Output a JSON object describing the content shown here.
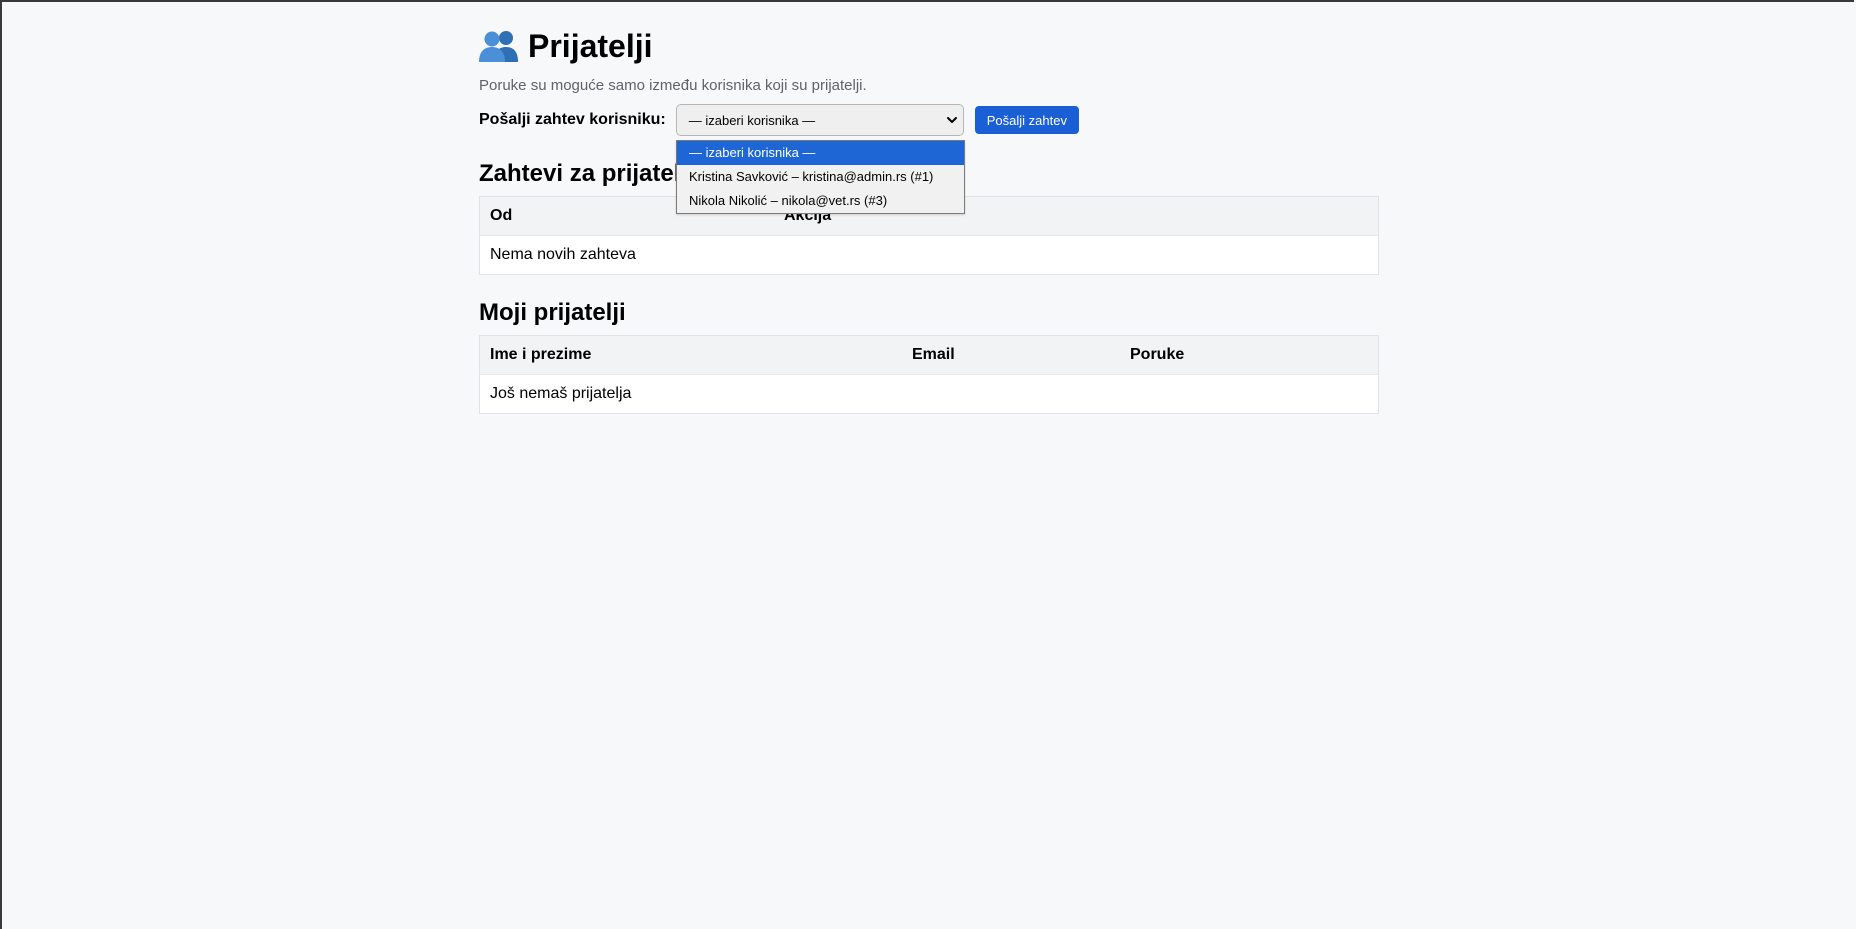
{
  "page": {
    "title": "Prijatelji",
    "title_icon": "people-icon",
    "subtitle": "Poruke su moguće samo između korisnika koji su prijatelji."
  },
  "request_form": {
    "label": "Pošalji zahtev korisniku:",
    "select_value": "— izaberi korisnika —",
    "button_label": "Pošalji zahtev",
    "accent_color": "#1a5fd6",
    "options": [
      "— izaberi korisnika —",
      "Kristina Savković – kristina@admin.rs (#1)",
      "Nikola Nikolić – nikola@vet.rs (#3)"
    ]
  },
  "requests_section": {
    "heading": "Zahtevi za prijatelj",
    "columns": [
      "Od",
      "Akcija"
    ],
    "empty_text": "Nema novih zahteva"
  },
  "friends_section": {
    "heading": "Moji prijatelji",
    "columns": [
      "Ime i prezime",
      "Email",
      "Poruke"
    ],
    "empty_text": "Još nemaš prijatelja"
  }
}
